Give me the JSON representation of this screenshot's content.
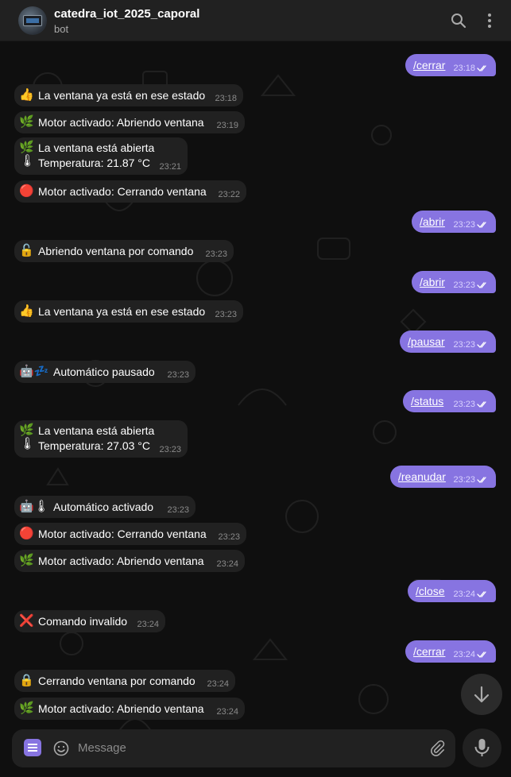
{
  "header": {
    "title": "catedra_iot_2025_caporal",
    "subtitle": "bot",
    "search_icon": "search-icon",
    "menu_icon": "more-vertical-icon"
  },
  "messages": [
    {
      "dir": "out",
      "text": "/cerrar",
      "time": "23:18"
    },
    {
      "dir": "in",
      "emoji": "👍",
      "text": "La ventana ya está en ese estado",
      "time": "23:18"
    },
    {
      "dir": "in",
      "emoji": "🌿",
      "text": "Motor activado: Abriendo ventana",
      "time": "23:19"
    },
    {
      "dir": "in",
      "emoji": "🌿",
      "text": "La ventana está abierta",
      "emoji2": "🌡",
      "text2": "Temperatura: 21.87 °C",
      "time": "23:21"
    },
    {
      "dir": "in",
      "emoji": "🔴",
      "text": "Motor activado: Cerrando ventana",
      "time": "23:22"
    },
    {
      "dir": "out",
      "text": "/abrir",
      "time": "23:23"
    },
    {
      "dir": "in",
      "emoji": "🔓",
      "text": "Abriendo ventana por comando",
      "time": "23:23"
    },
    {
      "dir": "out",
      "text": "/abrir",
      "time": "23:23"
    },
    {
      "dir": "in",
      "emoji": "👍",
      "text": "La ventana ya está en ese estado",
      "time": "23:23"
    },
    {
      "dir": "out",
      "text": "/pausar",
      "time": "23:23"
    },
    {
      "dir": "in",
      "emoji": "🤖💤",
      "text": "Automático pausado",
      "time": "23:23"
    },
    {
      "dir": "out",
      "text": "/status",
      "time": "23:23"
    },
    {
      "dir": "in",
      "emoji": "🌿",
      "text": "La ventana está abierta",
      "emoji2": "🌡",
      "text2": "Temperatura: 27.03 °C",
      "time": "23:23"
    },
    {
      "dir": "out",
      "text": "/reanudar",
      "time": "23:23"
    },
    {
      "dir": "in",
      "emoji": "🤖🌡",
      "text": "Automático activado",
      "time": "23:23"
    },
    {
      "dir": "in",
      "emoji": "🔴",
      "text": "Motor activado: Cerrando ventana",
      "time": "23:23"
    },
    {
      "dir": "in",
      "emoji": "🌿",
      "text": "Motor activado: Abriendo ventana",
      "time": "23:24"
    },
    {
      "dir": "out",
      "text": "/close",
      "time": "23:24"
    },
    {
      "dir": "in",
      "emoji": "❌",
      "text": "Comando invalido",
      "time": "23:24"
    },
    {
      "dir": "out",
      "text": "/cerrar",
      "time": "23:24"
    },
    {
      "dir": "in",
      "emoji": "🔒",
      "text": "Cerrando ventana por comando",
      "time": "23:24"
    },
    {
      "dir": "in",
      "emoji": "🌿",
      "text": "Motor activado: Abriendo ventana",
      "time": "23:24"
    }
  ],
  "composer": {
    "placeholder": "Message",
    "menu_icon": "bot-menu-icon",
    "emoji_icon": "smile-icon",
    "attach_icon": "paperclip-icon",
    "mic_icon": "microphone-icon",
    "scroll_icon": "arrow-down-icon"
  },
  "colors": {
    "outgoing_bubble": "#8774e1",
    "incoming_bubble": "#212121",
    "header": "#212121",
    "background": "#0f0f0f"
  }
}
